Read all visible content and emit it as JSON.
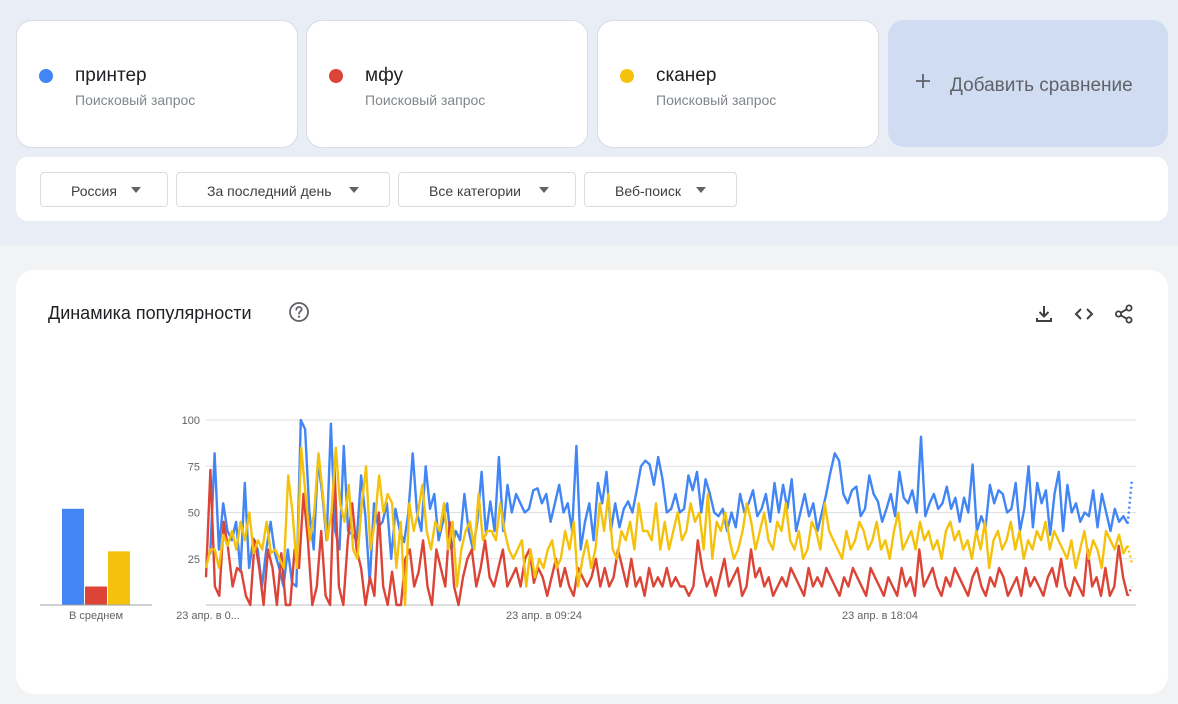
{
  "terms": [
    {
      "name": "принтер",
      "subtitle": "Поисковый запрос",
      "color": "#4285f4"
    },
    {
      "name": "мфу",
      "subtitle": "Поисковый запрос",
      "color": "#db4437"
    },
    {
      "name": "сканер",
      "subtitle": "Поисковый запрос",
      "color": "#f4c20d"
    }
  ],
  "add_compare": {
    "label": "Добавить сравнение",
    "icon": "plus-icon"
  },
  "filters": [
    {
      "label": "Россия"
    },
    {
      "label": "За последний день"
    },
    {
      "label": "Все категории"
    },
    {
      "label": "Веб-поиск"
    }
  ],
  "chart_header": {
    "title": "Динамика популярности",
    "icons": [
      "help-icon",
      "download-icon",
      "embed-code-icon",
      "share-icon"
    ]
  },
  "chart_data": [
    {
      "type": "bar",
      "categories": [
        "принтер",
        "мфу",
        "сканер"
      ],
      "values": [
        52,
        10,
        29
      ],
      "xlabel": "В среднем",
      "ylim": [
        0,
        100
      ],
      "colors": [
        "#4285f4",
        "#db4437",
        "#f4c20d"
      ]
    },
    {
      "type": "line",
      "yticks": [
        100,
        75,
        50,
        25
      ],
      "ylim": [
        0,
        100
      ],
      "x_tick_labels": [
        "23 апр. в 0...",
        "23 апр. в 09:24",
        "23 апр. в 18:04"
      ],
      "grid": true,
      "series": [
        {
          "name": "принтер",
          "color": "#4285f4",
          "values": [
            25,
            28,
            82,
            30,
            55,
            40,
            35,
            45,
            18,
            66,
            20,
            36,
            30,
            10,
            30,
            45,
            28,
            20,
            10,
            30,
            12,
            10,
            100,
            95,
            50,
            30,
            78,
            60,
            35,
            98,
            40,
            30,
            86,
            40,
            38,
            35,
            70,
            48,
            12,
            55,
            42,
            45,
            55,
            25,
            52,
            40,
            34,
            50,
            82,
            50,
            40,
            75,
            52,
            60,
            35,
            45,
            55,
            30,
            40,
            35,
            60,
            40,
            30,
            45,
            72,
            38,
            56,
            40,
            80,
            40,
            65,
            50,
            60,
            55,
            50,
            52,
            62,
            63,
            55,
            60,
            45,
            55,
            65,
            50,
            55,
            40,
            86,
            30,
            45,
            55,
            35,
            66,
            55,
            72,
            40,
            55,
            42,
            52,
            56,
            50,
            62,
            75,
            78,
            76,
            65,
            80,
            68,
            50,
            52,
            60,
            50,
            52,
            70,
            62,
            72,
            50,
            68,
            60,
            50,
            48,
            52,
            40,
            50,
            42,
            60,
            50,
            55,
            62,
            48,
            52,
            60,
            45,
            66,
            50,
            65,
            52,
            68,
            40,
            50,
            60,
            48,
            55,
            40,
            50,
            60,
            72,
            82,
            78,
            60,
            55,
            62,
            64,
            48,
            52,
            70,
            60,
            56,
            45,
            52,
            60,
            48,
            72,
            58,
            55,
            62,
            50,
            91,
            48,
            55,
            60,
            52,
            55,
            64,
            52,
            58,
            45,
            58,
            50,
            76,
            40,
            48,
            42,
            65,
            55,
            62,
            60,
            50,
            52,
            66,
            40,
            52,
            75,
            42,
            66,
            55,
            62,
            38,
            60,
            72,
            40,
            65,
            50,
            55,
            45,
            50,
            48,
            62,
            42,
            60,
            50,
            40,
            52,
            45,
            48,
            44,
            68
          ]
        },
        {
          "name": "мфу",
          "color": "#db4437",
          "values": [
            15,
            73,
            10,
            5,
            45,
            30,
            10,
            20,
            18,
            5,
            0,
            35,
            20,
            0,
            30,
            20,
            0,
            28,
            0,
            0,
            30,
            20,
            60,
            35,
            0,
            10,
            40,
            5,
            0,
            75,
            10,
            0,
            35,
            55,
            30,
            20,
            0,
            15,
            5,
            50,
            10,
            0,
            18,
            0,
            0,
            25,
            30,
            10,
            18,
            35,
            10,
            0,
            30,
            20,
            10,
            45,
            10,
            0,
            15,
            25,
            30,
            10,
            20,
            35,
            15,
            10,
            20,
            30,
            10,
            15,
            20,
            10,
            25,
            30,
            12,
            20,
            15,
            5,
            15,
            25,
            10,
            20,
            10,
            5,
            20,
            15,
            10,
            15,
            25,
            10,
            20,
            10,
            15,
            30,
            20,
            10,
            25,
            10,
            15,
            5,
            20,
            10,
            15,
            10,
            20,
            10,
            15,
            10,
            10,
            5,
            10,
            35,
            20,
            10,
            15,
            5,
            15,
            25,
            10,
            15,
            20,
            5,
            10,
            30,
            15,
            20,
            10,
            15,
            5,
            10,
            15,
            10,
            20,
            15,
            10,
            5,
            20,
            10,
            15,
            10,
            20,
            15,
            10,
            5,
            15,
            10,
            20,
            15,
            10,
            5,
            20,
            15,
            10,
            5,
            15,
            10,
            5,
            20,
            10,
            15,
            5,
            30,
            10,
            15,
            20,
            10,
            5,
            15,
            10,
            20,
            15,
            10,
            5,
            15,
            20,
            10,
            5,
            15,
            10,
            20,
            15,
            5,
            10,
            15,
            5,
            20,
            10,
            15,
            10,
            5,
            15,
            20,
            10,
            25,
            10,
            5,
            15,
            10,
            5,
            30,
            10,
            15,
            5,
            20,
            5,
            10,
            32,
            15,
            5,
            10
          ]
        },
        {
          "name": "сканер",
          "color": "#f4c20d",
          "values": [
            20,
            30,
            30,
            20,
            38,
            32,
            40,
            30,
            45,
            35,
            50,
            28,
            35,
            30,
            45,
            28,
            30,
            25,
            20,
            70,
            50,
            20,
            85,
            60,
            35,
            50,
            82,
            60,
            35,
            50,
            85,
            55,
            45,
            65,
            30,
            25,
            55,
            75,
            30,
            45,
            70,
            50,
            60,
            55,
            20,
            45,
            0,
            55,
            40,
            50,
            65,
            40,
            30,
            45,
            40,
            55,
            30,
            45,
            10,
            30,
            40,
            45,
            30,
            60,
            35,
            40,
            40,
            35,
            55,
            40,
            30,
            25,
            30,
            35,
            10,
            30,
            15,
            25,
            20,
            30,
            35,
            20,
            25,
            40,
            30,
            45,
            10,
            25,
            35,
            20,
            30,
            55,
            40,
            60,
            30,
            25,
            40,
            35,
            45,
            30,
            55,
            40,
            40,
            35,
            55,
            30,
            45,
            30,
            40,
            50,
            35,
            40,
            55,
            45,
            50,
            30,
            60,
            25,
            45,
            40,
            50,
            35,
            25,
            30,
            40,
            55,
            45,
            30,
            40,
            50,
            35,
            30,
            45,
            40,
            55,
            35,
            30,
            40,
            25,
            30,
            45,
            40,
            30,
            55,
            40,
            35,
            30,
            25,
            40,
            30,
            35,
            45,
            40,
            30,
            35,
            45,
            30,
            35,
            25,
            40,
            50,
            30,
            35,
            40,
            30,
            45,
            35,
            40,
            30,
            35,
            25,
            40,
            45,
            35,
            40,
            30,
            35,
            25,
            40,
            30,
            45,
            20,
            35,
            40,
            30,
            35,
            45,
            30,
            40,
            25,
            35,
            30,
            40,
            35,
            45,
            30,
            40,
            35,
            30,
            25,
            35,
            20,
            30,
            40,
            25,
            35,
            30,
            20,
            40,
            35,
            30,
            38,
            28,
            32,
            22
          ]
        }
      ]
    }
  ]
}
